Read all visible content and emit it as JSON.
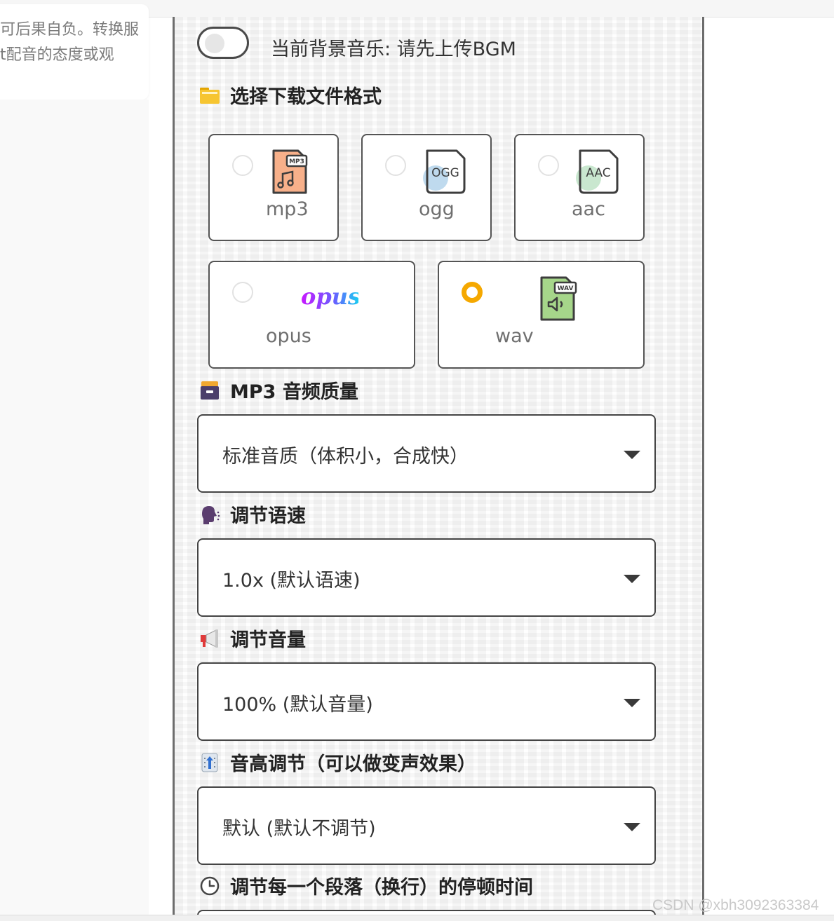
{
  "left_card": {
    "line1": "可后果自负。转换服",
    "line2": "t配音的态度或观"
  },
  "bgm": {
    "label": "当前背景音乐: 请先上传BGM",
    "enabled": false
  },
  "download_format": {
    "title": "选择下载文件格式",
    "icon": "folder-icon",
    "options": [
      {
        "label": "mp3",
        "icon": "mp3-file-icon",
        "badge": "MP3",
        "selected": false
      },
      {
        "label": "ogg",
        "icon": "ogg-file-icon",
        "badge": "OGG",
        "selected": false
      },
      {
        "label": "aac",
        "icon": "aac-file-icon",
        "badge": "AAC",
        "selected": false
      },
      {
        "label": "opus",
        "icon": "opus-logo-icon",
        "logo_text": "opus",
        "selected": false
      },
      {
        "label": "wav",
        "icon": "wav-file-icon",
        "badge": "WAV",
        "selected": true
      }
    ]
  },
  "mp3_quality": {
    "title": "MP3 音频质量",
    "icon": "card-file-box-icon",
    "value": "标准音质（体积小，合成快）"
  },
  "speed": {
    "title": "调节语速",
    "icon": "speaking-head-icon",
    "value": "1.0x (默认语速)"
  },
  "volume": {
    "title": "调节音量",
    "icon": "megaphone-icon",
    "value": "100% (默认音量)"
  },
  "pitch": {
    "title": "音高调节（可以做变声效果）",
    "icon": "pitch-slider-icon",
    "value": "默认 (默认不调节)"
  },
  "pause": {
    "title": "调节每一个段落（换行）的停顿时间",
    "icon": "clock-icon"
  },
  "watermark": "CSDN @xbh3092363384",
  "colors": {
    "accent": "#f5a800",
    "border": "#555555",
    "panel_border": "#6d6d6d"
  }
}
